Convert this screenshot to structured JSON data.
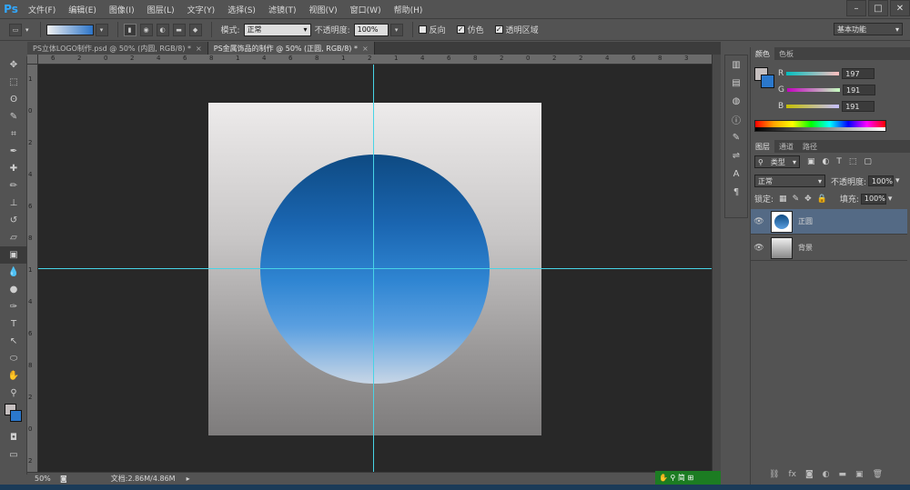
{
  "app": {
    "logo": "Ps"
  },
  "menu": [
    "文件(F)",
    "编辑(E)",
    "图像(I)",
    "图层(L)",
    "文字(Y)",
    "选择(S)",
    "滤镜(T)",
    "视图(V)",
    "窗口(W)",
    "帮助(H)"
  ],
  "options": {
    "mode_label": "模式:",
    "mode_value": "正常",
    "opacity_label": "不透明度:",
    "opacity_value": "100%",
    "reverse_label": "反向",
    "dither_label": "仿色",
    "transparency_label": "透明区域",
    "workspace": "基本功能"
  },
  "tabs": [
    {
      "label": "PS立体LOGO制作.psd @ 50% (内圆, RGB/8) *"
    },
    {
      "label": "PS金属饰品的制作 @ 50% (正圆, RGB/8) *"
    }
  ],
  "ruler_top": [
    "6",
    "2",
    "0",
    "2",
    "4",
    "6",
    "8",
    "1",
    "4",
    "6",
    "8",
    "1",
    "2",
    "1",
    "4",
    "6",
    "8",
    "2",
    "0",
    "2",
    "2",
    "4",
    "6",
    "8",
    "3"
  ],
  "ruler_left": [
    "1",
    "0",
    "2",
    "4",
    "6",
    "8",
    "1",
    "4",
    "6",
    "8",
    "2",
    "0",
    "2"
  ],
  "status": {
    "zoom": "50%",
    "doc_info": "文档:2.86M/4.86M"
  },
  "color_panel": {
    "tabs": [
      "颜色",
      "色板"
    ],
    "r_label": "R",
    "r_value": "197",
    "g_label": "G",
    "g_value": "191",
    "b_label": "B",
    "b_value": "191"
  },
  "layers_panel": {
    "tabs": [
      "图层",
      "通道",
      "路径"
    ],
    "filter_label": "类型",
    "blend_mode": "正常",
    "opacity_label": "不透明度:",
    "opacity_value": "100%",
    "lock_label": "锁定:",
    "fill_label": "填充:",
    "fill_value": "100%",
    "layers": [
      {
        "name": "正圆",
        "selected": true
      },
      {
        "name": "背景",
        "selected": false
      }
    ]
  },
  "colors": {
    "guide": "#48d4e6",
    "circle_top": "#0e4a82",
    "circle_bottom": "#c8d6e6",
    "selected_layer": "#546a85"
  }
}
